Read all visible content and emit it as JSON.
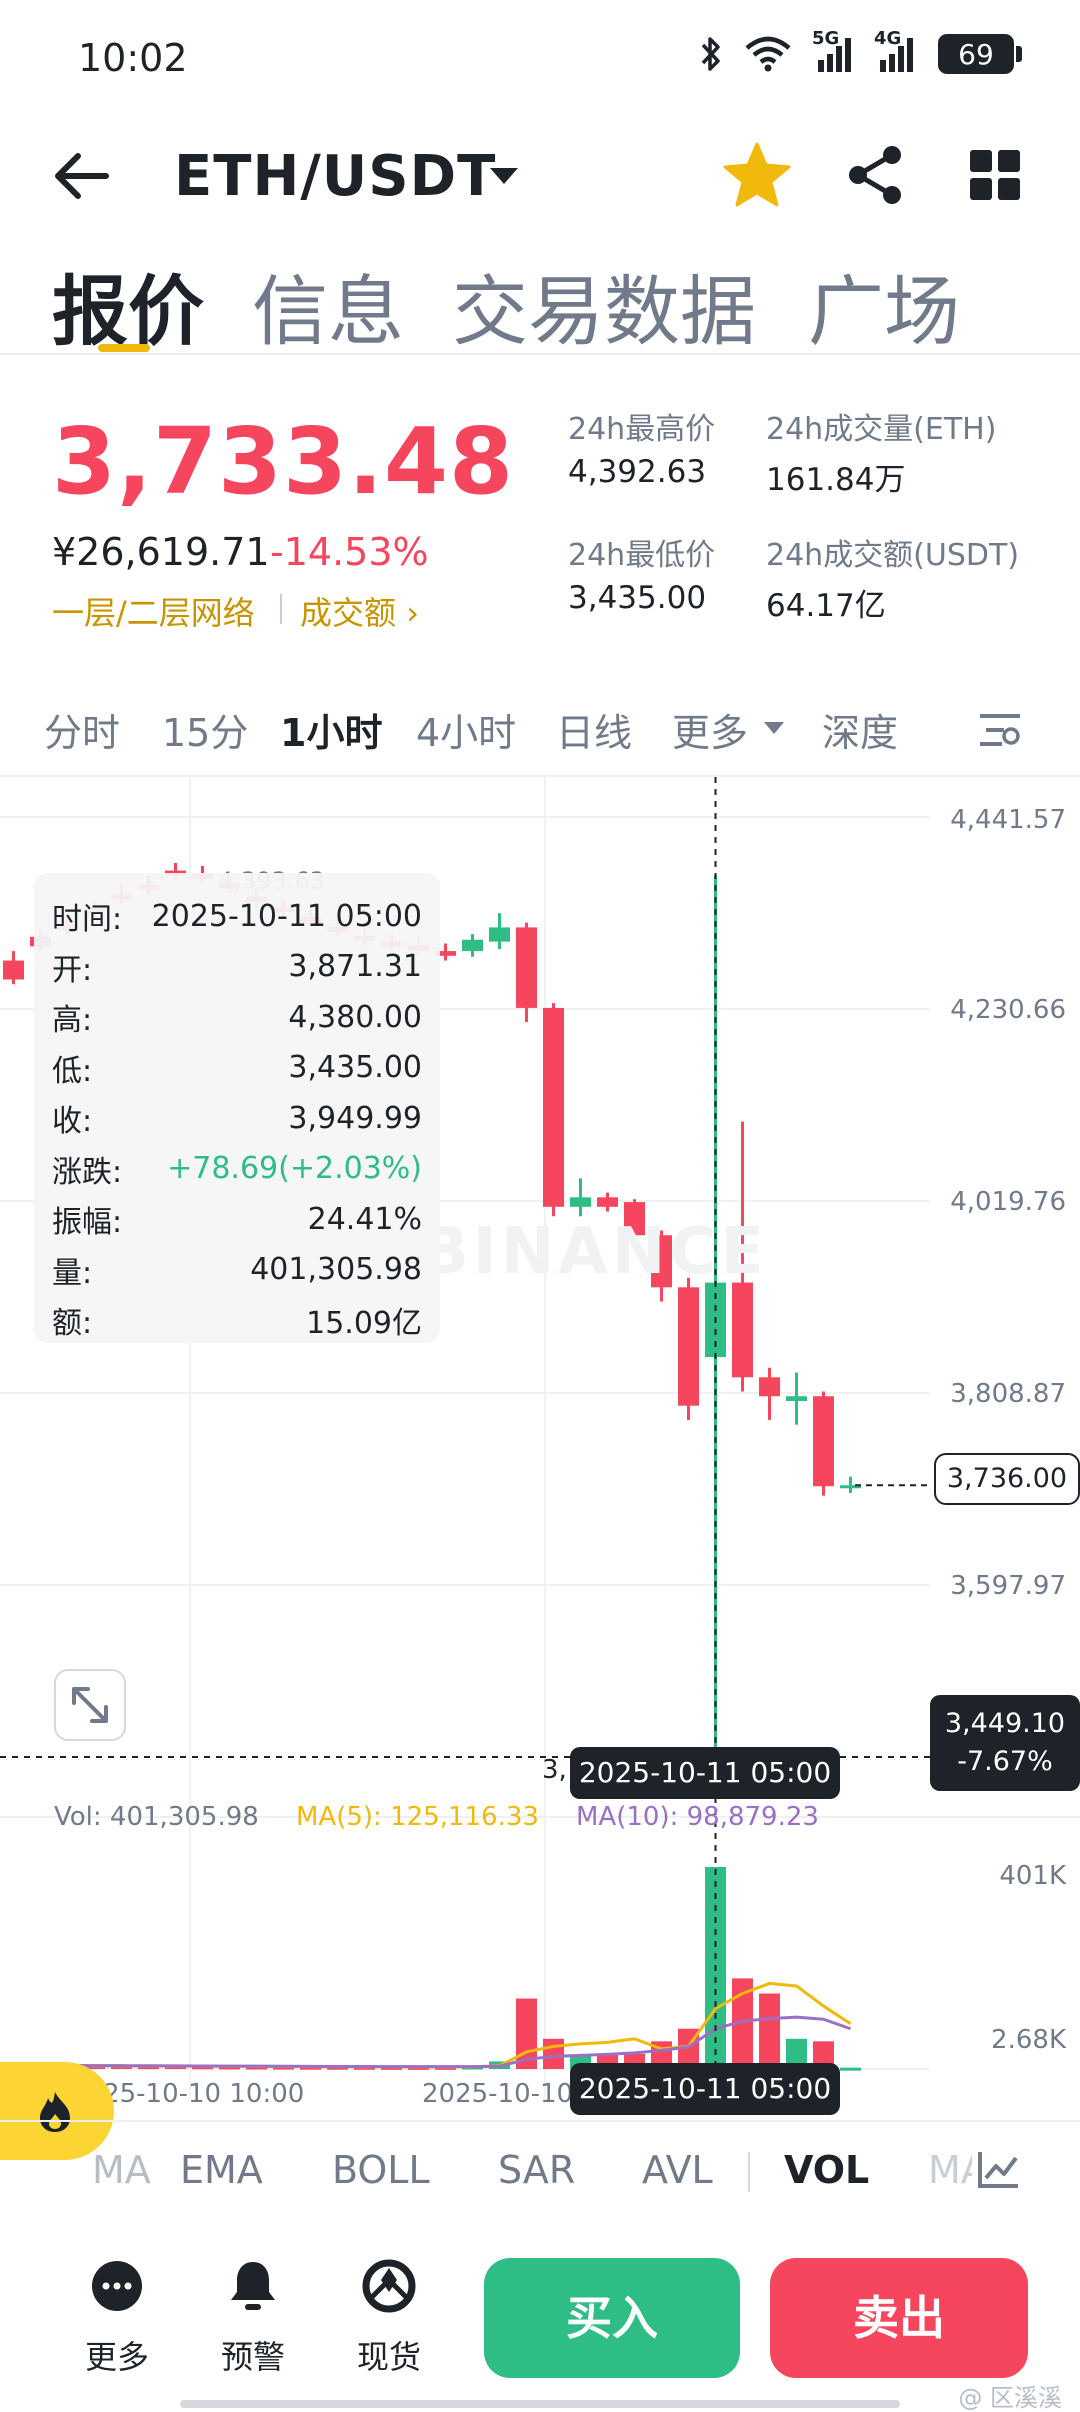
{
  "status_bar": {
    "time": "10:02",
    "network_a": "5G",
    "network_b": "4G",
    "battery": "69"
  },
  "header": {
    "pair": "ETH/USDT",
    "icons": [
      "back-icon",
      "star-icon",
      "share-icon",
      "grid-icon"
    ],
    "star_color": "#f0b90b"
  },
  "main_tabs": [
    "报价",
    "信息",
    "交易数据",
    "广场"
  ],
  "price": {
    "last": "3,733.48",
    "cny": "¥26,619.71",
    "change_pct": "-14.53%",
    "network_link": "一层/二层网络",
    "turnover_link": "成交额",
    "up_color": "#2ebd85",
    "down_color": "#f6465d"
  },
  "stats": {
    "high_label": "24h最高价",
    "high_value": "4,392.63",
    "low_label": "24h最低价",
    "low_value": "3,435.00",
    "vol_eth_label": "24h成交量(ETH)",
    "vol_eth_value": "161.84万",
    "vol_usdt_label": "24h成交额(USDT)",
    "vol_usdt_value": "64.17亿"
  },
  "intervals": [
    "分时",
    "15分",
    "1小时",
    "4小时",
    "日线",
    "更多",
    "深度"
  ],
  "chart": {
    "price_axis": [
      "4,441.57",
      "4,230.66",
      "4,019.76",
      "3,808.87",
      "3,597.97"
    ],
    "high_marker": "4,393.63",
    "watermark": "BINANCE",
    "last_price_tag": "3,736.00",
    "cross_price": "3,449.10",
    "cross_pct": "-7.67%",
    "cross_time": "2025-10-11 05:00",
    "cross_left_fragment": "3,",
    "info_panel": [
      {
        "k": "时间:",
        "v": "2025-10-11 05:00"
      },
      {
        "k": "开:",
        "v": "3,871.31"
      },
      {
        "k": "高:",
        "v": "4,380.00"
      },
      {
        "k": "低:",
        "v": "3,435.00"
      },
      {
        "k": "收:",
        "v": "3,949.99"
      },
      {
        "k": "涨跌:",
        "v": "+78.69(+2.03%)"
      },
      {
        "k": "振幅:",
        "v": "24.41%"
      },
      {
        "k": "量:",
        "v": "401,305.98"
      },
      {
        "k": "额:",
        "v": "15.09亿"
      }
    ],
    "vol_legend": {
      "vol": "Vol: 401,305.98",
      "ma5": "MA(5): 125,116.33",
      "ma10": "MA(10): 98,879.23",
      "ma5_color": "#f0b90b",
      "ma10_color": "#9b6fc6"
    },
    "vol_axis": [
      "401K",
      "2.68K"
    ],
    "time_axis": [
      "2025-10-10 10:00",
      "2025-10-10"
    ],
    "candles": [
      {
        "o": 4290,
        "h": 4300,
        "l": 4265,
        "c": 4270
      },
      {
        "o": 4315,
        "h": 4322,
        "l": 4300,
        "c": 4305
      },
      {
        "o": 4328,
        "h": 4335,
        "l": 4318,
        "c": 4322
      },
      {
        "o": 4345,
        "h": 4352,
        "l": 4336,
        "c": 4340
      },
      {
        "o": 4360,
        "h": 4372,
        "l": 4350,
        "c": 4355
      },
      {
        "o": 4370,
        "h": 4380,
        "l": 4360,
        "c": 4365
      },
      {
        "o": 4385,
        "h": 4393,
        "l": 4375,
        "c": 4380
      },
      {
        "o": 4382,
        "h": 4390,
        "l": 4372,
        "c": 4376
      },
      {
        "o": 4372,
        "h": 4380,
        "l": 4362,
        "c": 4366
      },
      {
        "o": 4358,
        "h": 4366,
        "l": 4346,
        "c": 4352
      },
      {
        "o": 4346,
        "h": 4354,
        "l": 4336,
        "c": 4341
      },
      {
        "o": 4336,
        "h": 4344,
        "l": 4326,
        "c": 4330
      },
      {
        "o": 4326,
        "h": 4334,
        "l": 4316,
        "c": 4320
      },
      {
        "o": 4316,
        "h": 4324,
        "l": 4306,
        "c": 4311
      },
      {
        "o": 4310,
        "h": 4318,
        "l": 4300,
        "c": 4305
      },
      {
        "o": 4306,
        "h": 4314,
        "l": 4296,
        "c": 4300
      },
      {
        "o": 4300,
        "h": 4308,
        "l": 4290,
        "c": 4295
      },
      {
        "o": 4300,
        "h": 4318,
        "l": 4294,
        "c": 4312
      },
      {
        "o": 4310,
        "h": 4340,
        "l": 4302,
        "c": 4325
      },
      {
        "o": 4325,
        "h": 4330,
        "l": 4225,
        "c": 4240
      },
      {
        "o": 4240,
        "h": 4245,
        "l": 4020,
        "c": 4030
      },
      {
        "o": 4030,
        "h": 4060,
        "l": 4020,
        "c": 4040
      },
      {
        "o": 4040,
        "h": 4045,
        "l": 4025,
        "c": 4030
      },
      {
        "o": 4035,
        "h": 4038,
        "l": 3995,
        "c": 4000
      },
      {
        "o": 4000,
        "h": 4005,
        "l": 3930,
        "c": 3945
      },
      {
        "o": 3945,
        "h": 3955,
        "l": 3805,
        "c": 3820
      },
      {
        "o": 3871.31,
        "h": 4380,
        "l": 3435,
        "c": 3949.99
      },
      {
        "o": 3950,
        "h": 4120,
        "l": 3835,
        "c": 3850
      },
      {
        "o": 3850,
        "h": 3860,
        "l": 3805,
        "c": 3830
      },
      {
        "o": 3825,
        "h": 3855,
        "l": 3800,
        "c": 3830
      },
      {
        "o": 3830,
        "h": 3835,
        "l": 3725,
        "c": 3735
      },
      {
        "o": 3735,
        "h": 3745,
        "l": 3728,
        "c": 3736
      }
    ],
    "volumes": [
      8000,
      7000,
      6500,
      6000,
      6200,
      5800,
      6000,
      5500,
      5200,
      5000,
      4800,
      4600,
      4500,
      4400,
      4300,
      4200,
      4300,
      5000,
      15000,
      140000,
      60000,
      25000,
      28000,
      30000,
      55000,
      80000,
      401305.98,
      180000,
      150000,
      60000,
      55000,
      2680
    ],
    "ma5": [
      7000,
      6800,
      6500,
      6200,
      6100,
      5900,
      5800,
      5600,
      5400,
      5200,
      5000,
      4800,
      4600,
      4500,
      4400,
      4300,
      4300,
      4500,
      6200,
      34000,
      45000,
      50000,
      53000,
      60000,
      40000,
      45000,
      120000,
      150000,
      170000,
      165000,
      125116.33,
      90000
    ],
    "ma10": [
      7500,
      7300,
      7000,
      6800,
      6600,
      6400,
      6200,
      6000,
      5800,
      5600,
      5400,
      5200,
      5000,
      4900,
      4800,
      4700,
      4600,
      4600,
      5500,
      19000,
      25000,
      27000,
      29000,
      32000,
      37000,
      44000,
      80000,
      95000,
      100000,
      103000,
      98879.23,
      80000
    ]
  },
  "indicators": [
    "MA",
    "EMA",
    "BOLL",
    "SAR",
    "AVL",
    "VOL",
    "MACD"
  ],
  "bottom_bar": {
    "more": "更多",
    "alert": "预警",
    "spot": "现货",
    "buy": "买入",
    "sell": "卖出",
    "corner": "@ 区溪溪"
  }
}
